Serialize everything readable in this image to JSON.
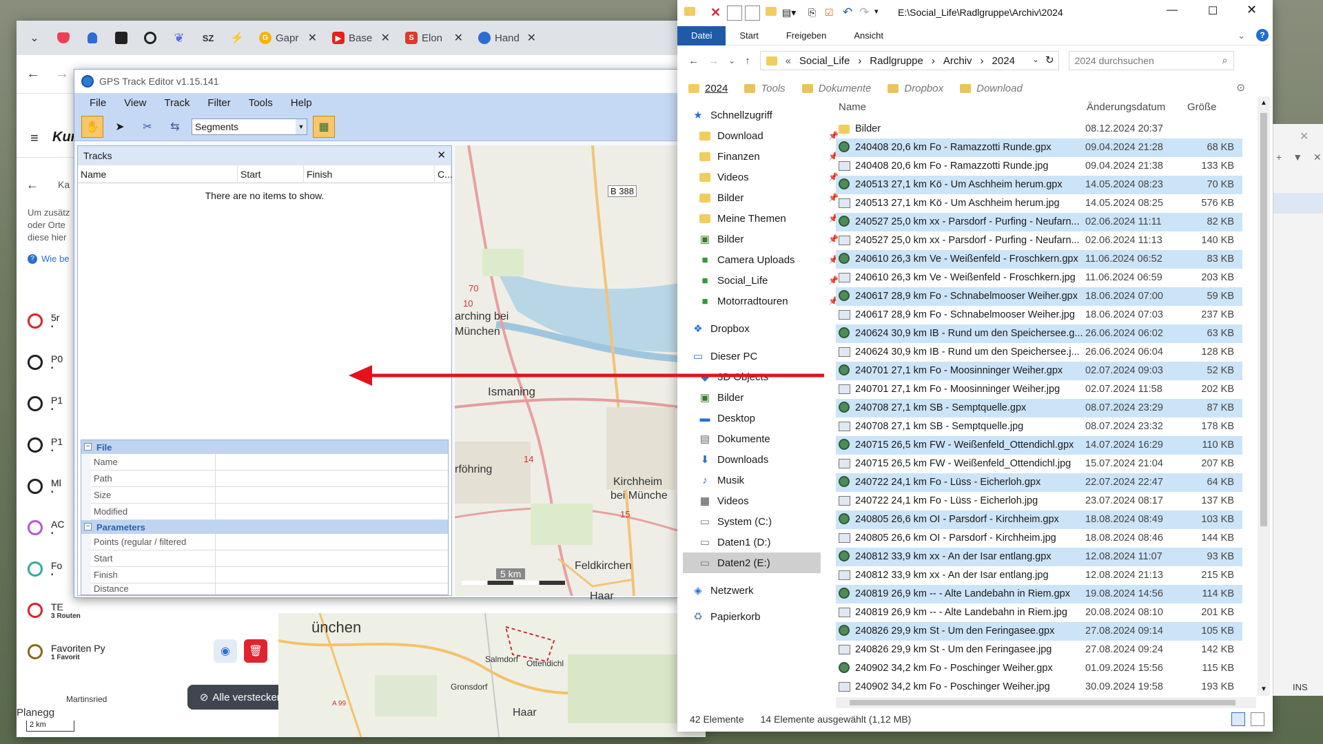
{
  "browser": {
    "tabs": [
      {
        "label": "Gapr",
        "icon": "google-icon",
        "color": "#f4b400"
      },
      {
        "label": "Base",
        "icon": "youtube-icon",
        "color": "#e62117"
      },
      {
        "label": "Elon",
        "icon": "s-icon",
        "color": "#d93a2b"
      },
      {
        "label": "Hand",
        "icon": "browser-icon",
        "color": "#2b6cd4"
      }
    ],
    "sz_label": "SZ"
  },
  "webapp": {
    "logo": "Kur",
    "back_label": "Ka",
    "info_lines": [
      "Um zusätz",
      "oder Orte",
      "diese hier"
    ],
    "help_link": "Wie be",
    "items": [
      {
        "label": "5r",
        "color": "#d9262b"
      },
      {
        "label": "P0",
        "color": "#222222"
      },
      {
        "label": "P1",
        "color": "#222222"
      },
      {
        "label": "P1",
        "color": "#222222"
      },
      {
        "label": "Ml",
        "color": "#222222"
      },
      {
        "label": "AC",
        "color": "#b25bd2"
      },
      {
        "label": "Fo",
        "color": "#3aa6a6"
      },
      {
        "label": "TE",
        "color": "#d9262b",
        "sub": "3 Routen"
      },
      {
        "label": "Favoriten Py",
        "color": "#8b6b1a",
        "sub": "1 Favorit"
      }
    ],
    "hide_all": "Alle verstecken",
    "map_labels": {
      "muenchen": "ünchen",
      "salmdorf": "Salmdorf",
      "ottendichl": "Ottendichl",
      "gronsdorf": "Gronsdorf",
      "haar": "Haar",
      "martinsried": "Martinsried",
      "planegg": "Planegg",
      "scale": "2 km",
      "a99": "A 99"
    }
  },
  "gps": {
    "title": "GPS Track Editor v1.15.141",
    "menu": [
      "File",
      "View",
      "Track",
      "Filter",
      "Tools",
      "Help"
    ],
    "segments": "Segments",
    "tracks_title": "Tracks",
    "columns": [
      "Name",
      "Start",
      "Finish",
      "C..."
    ],
    "empty": "There are no items to show.",
    "groups": {
      "file": "File",
      "params": "Parameters"
    },
    "file_props": [
      "Name",
      "Path",
      "Size",
      "Modified"
    ],
    "param_props": [
      "Points (regular / filtered",
      "Start",
      "Finish",
      "Distance"
    ],
    "map_labels": {
      "b388": "B 388",
      "garching": "arching bei",
      "muenchen1": "München",
      "ismaning": "Ismaning",
      "unterfoehring": "rföhring",
      "kirchheim": "Kirchheim",
      "beimuenche": "bei Münche",
      "feldkirchen": "Feldkirchen",
      "haar": "Haar",
      "scale": "5 km",
      "n14": "14",
      "n15": "15",
      "n70": "70",
      "n10": "10"
    }
  },
  "explorer": {
    "path_title": "E:\\Social_Life\\Radlgruppe\\Archiv\\2024",
    "ribbon": [
      "Datei",
      "Start",
      "Freigeben",
      "Ansicht"
    ],
    "breadcrumb": [
      "Social_Life",
      "Radlgruppe",
      "Archiv",
      "2024"
    ],
    "search_placeholder": "2024 durchsuchen",
    "quick": [
      "2024",
      "Tools",
      "Dokumente",
      "Dropbox",
      "Download"
    ],
    "nav": [
      {
        "label": "Schnellzugriff",
        "icon": "star-icon",
        "indent": 0,
        "pin": false
      },
      {
        "label": "Download",
        "icon": "folder-icon",
        "indent": 1,
        "pin": true
      },
      {
        "label": "Finanzen",
        "icon": "folder-icon",
        "indent": 1,
        "pin": true
      },
      {
        "label": "Videos",
        "icon": "folder-icon",
        "indent": 1,
        "pin": true
      },
      {
        "label": "Bilder",
        "icon": "folder-icon",
        "indent": 1,
        "pin": true
      },
      {
        "label": "Meine Themen",
        "icon": "folder-icon",
        "indent": 1,
        "pin": true
      },
      {
        "label": "Bilder",
        "icon": "pictures-icon",
        "indent": 1,
        "pin": true
      },
      {
        "label": "Camera Uploads",
        "icon": "dropbox-folder-icon",
        "indent": 1,
        "pin": true
      },
      {
        "label": "Social_Life",
        "icon": "dropbox-folder-icon",
        "indent": 1,
        "pin": true
      },
      {
        "label": "Motorradtouren",
        "icon": "dropbox-folder-icon",
        "indent": 1,
        "pin": true
      },
      {
        "label": "Dropbox",
        "icon": "dropbox-icon",
        "indent": 0,
        "pin": false
      },
      {
        "label": "Dieser PC",
        "icon": "pc-icon",
        "indent": 0,
        "pin": false
      },
      {
        "label": "3D Objects",
        "icon": "3d-icon",
        "indent": 1,
        "pin": false
      },
      {
        "label": "Bilder",
        "icon": "pictures-icon",
        "indent": 1,
        "pin": false
      },
      {
        "label": "Desktop",
        "icon": "desktop-icon",
        "indent": 1,
        "pin": false
      },
      {
        "label": "Dokumente",
        "icon": "documents-icon",
        "indent": 1,
        "pin": false
      },
      {
        "label": "Downloads",
        "icon": "download-icon",
        "indent": 1,
        "pin": false
      },
      {
        "label": "Musik",
        "icon": "music-icon",
        "indent": 1,
        "pin": false
      },
      {
        "label": "Videos",
        "icon": "video-icon",
        "indent": 1,
        "pin": false
      },
      {
        "label": "System (C:)",
        "icon": "drive-icon",
        "indent": 1,
        "pin": false
      },
      {
        "label": "Daten1 (D:)",
        "icon": "drive-icon",
        "indent": 1,
        "pin": false
      },
      {
        "label": "Daten2 (E:)",
        "icon": "drive-icon",
        "indent": 1,
        "pin": false,
        "selected": true
      },
      {
        "label": "Netzwerk",
        "icon": "network-icon",
        "indent": 0,
        "pin": false
      },
      {
        "label": "Papierkorb",
        "icon": "recycle-icon",
        "indent": 0,
        "pin": false
      }
    ],
    "columns": {
      "name": "Name",
      "date": "Änderungsdatum",
      "size": "Größe"
    },
    "files": [
      {
        "name": "Bilder",
        "date": "08.12.2024 20:37",
        "size": "",
        "type": "folder",
        "sel": false
      },
      {
        "name": "240408 20,6 km Fo - Ramazzotti Runde.gpx",
        "date": "09.04.2024 21:28",
        "size": "68 KB",
        "type": "gpx",
        "sel": true
      },
      {
        "name": "240408 20,6 km Fo - Ramazzotti Runde.jpg",
        "date": "09.04.2024 21:38",
        "size": "133 KB",
        "type": "jpg",
        "sel": false
      },
      {
        "name": "240513 27,1 km Kö - Um Aschheim herum.gpx",
        "date": "14.05.2024 08:23",
        "size": "70 KB",
        "type": "gpx",
        "sel": true
      },
      {
        "name": "240513 27,1 km Kö - Um Aschheim herum.jpg",
        "date": "14.05.2024 08:25",
        "size": "576 KB",
        "type": "jpg",
        "sel": false
      },
      {
        "name": "240527 25,0 km xx - Parsdorf - Purfing - Neufarn...",
        "date": "02.06.2024 11:11",
        "size": "82 KB",
        "type": "gpx",
        "sel": true
      },
      {
        "name": "240527 25,0 km xx - Parsdorf - Purfing - Neufarn...",
        "date": "02.06.2024 11:13",
        "size": "140 KB",
        "type": "jpg",
        "sel": false
      },
      {
        "name": "240610 26,3 km Ve - Weißenfeld - Froschkern.gpx",
        "date": "11.06.2024 06:52",
        "size": "83 KB",
        "type": "gpx",
        "sel": true
      },
      {
        "name": "240610 26,3 km Ve - Weißenfeld - Froschkern.jpg",
        "date": "11.06.2024 06:59",
        "size": "203 KB",
        "type": "jpg",
        "sel": false
      },
      {
        "name": "240617 28,9 km Fo - Schnabelmooser Weiher.gpx",
        "date": "18.06.2024 07:00",
        "size": "59 KB",
        "type": "gpx",
        "sel": true
      },
      {
        "name": "240617 28,9 km Fo - Schnabelmooser Weiher.jpg",
        "date": "18.06.2024 07:03",
        "size": "237 KB",
        "type": "jpg",
        "sel": false
      },
      {
        "name": "240624 30,9 km IB - Rund um den Speichersee.g...",
        "date": "26.06.2024 06:02",
        "size": "63 KB",
        "type": "gpx",
        "sel": true
      },
      {
        "name": "240624 30,9 km IB - Rund um den Speichersee.j...",
        "date": "26.06.2024 06:04",
        "size": "128 KB",
        "type": "jpg",
        "sel": false
      },
      {
        "name": "240701 27,1 km Fo - Moosinninger Weiher.gpx",
        "date": "02.07.2024 09:03",
        "size": "52 KB",
        "type": "gpx",
        "sel": true
      },
      {
        "name": "240701 27,1 km Fo - Moosinninger Weiher.jpg",
        "date": "02.07.2024 11:58",
        "size": "202 KB",
        "type": "jpg",
        "sel": false
      },
      {
        "name": "240708 27,1 km SB - Semptquelle.gpx",
        "date": "08.07.2024 23:29",
        "size": "87 KB",
        "type": "gpx",
        "sel": true
      },
      {
        "name": "240708 27,1 km SB - Semptquelle.jpg",
        "date": "08.07.2024 23:32",
        "size": "178 KB",
        "type": "jpg",
        "sel": false
      },
      {
        "name": "240715 26,5 km FW - Weißenfeld_Ottendichl.gpx",
        "date": "14.07.2024 16:29",
        "size": "110 KB",
        "type": "gpx",
        "sel": true
      },
      {
        "name": "240715 26,5 km FW - Weißenfeld_Ottendichl.jpg",
        "date": "15.07.2024 21:04",
        "size": "207 KB",
        "type": "jpg",
        "sel": false
      },
      {
        "name": "240722 24,1 km Fo - Lüss - Eicherloh.gpx",
        "date": "22.07.2024 22:47",
        "size": "64 KB",
        "type": "gpx",
        "sel": true
      },
      {
        "name": "240722 24,1 km Fo - Lüss - Eicherloh.jpg",
        "date": "23.07.2024 08:17",
        "size": "137 KB",
        "type": "jpg",
        "sel": false
      },
      {
        "name": "240805 26,6 km OI - Parsdorf - Kirchheim.gpx",
        "date": "18.08.2024 08:49",
        "size": "103 KB",
        "type": "gpx",
        "sel": true
      },
      {
        "name": "240805 26,6 km OI - Parsdorf - Kirchheim.jpg",
        "date": "18.08.2024 08:46",
        "size": "144 KB",
        "type": "jpg",
        "sel": false
      },
      {
        "name": "240812 33,9 km xx - An der Isar entlang.gpx",
        "date": "12.08.2024 11:07",
        "size": "93 KB",
        "type": "gpx",
        "sel": true
      },
      {
        "name": "240812 33,9 km xx - An der Isar entlang.jpg",
        "date": "12.08.2024 21:13",
        "size": "215 KB",
        "type": "jpg",
        "sel": false
      },
      {
        "name": "240819 26,9 km -- - Alte Landebahn in Riem.gpx",
        "date": "19.08.2024 14:56",
        "size": "114 KB",
        "type": "gpx",
        "sel": true
      },
      {
        "name": "240819 26,9 km -- - Alte Landebahn in Riem.jpg",
        "date": "20.08.2024 08:10",
        "size": "201 KB",
        "type": "jpg",
        "sel": false
      },
      {
        "name": "240826 29,9 km St - Um den Feringasee.gpx",
        "date": "27.08.2024 09:14",
        "size": "105 KB",
        "type": "gpx",
        "sel": true
      },
      {
        "name": "240826 29,9 km St - Um den Feringasee.jpg",
        "date": "27.08.2024 09:24",
        "size": "142 KB",
        "type": "jpg",
        "sel": false
      },
      {
        "name": "240902 34,2 km Fo - Poschinger Weiher.gpx",
        "date": "01.09.2024 15:56",
        "size": "115 KB",
        "type": "gpx",
        "sel": false
      },
      {
        "name": "240902 34,2 km Fo - Poschinger Weiher.jpg",
        "date": "30.09.2024 19:58",
        "size": "193 KB",
        "type": "jpg",
        "sel": false
      }
    ],
    "status_count": "42 Elemente",
    "status_selected": "14 Elemente ausgewählt (1,12 MB)"
  },
  "behind": {
    "ins": "INS"
  },
  "colors": {
    "selection": "#cce4f7",
    "accent": "#1e5aa8",
    "arrow": "#e3131b"
  }
}
